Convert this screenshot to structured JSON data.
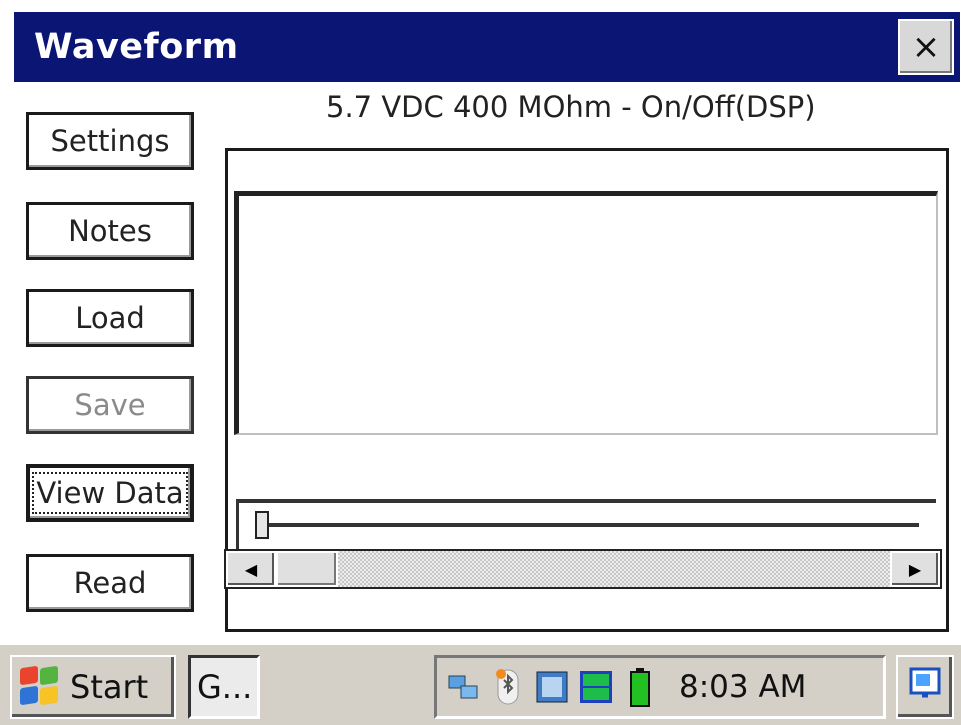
{
  "window": {
    "title": "Waveform",
    "close_label": "×"
  },
  "sidebar": {
    "buttons": [
      {
        "label": "Settings",
        "enabled": true
      },
      {
        "label": "Notes",
        "enabled": true
      },
      {
        "label": "Load",
        "enabled": true
      },
      {
        "label": "Save",
        "enabled": false
      },
      {
        "label": "View Data",
        "enabled": true,
        "focused": true
      },
      {
        "label": "Read",
        "enabled": true
      }
    ]
  },
  "main": {
    "header": "5.7 VDC 400 MOhm - On/Off(DSP)",
    "slider": {
      "value": 0
    },
    "scrollbar": {
      "left_arrow": "◀",
      "right_arrow": "▶",
      "position": 0
    }
  },
  "taskbar": {
    "start_label": "Start",
    "task_label": "G...",
    "tray_icons": [
      "network-icon",
      "bluetooth-icon",
      "sync-icon",
      "otg-icon",
      "battery-icon"
    ],
    "clock": "8:03 AM",
    "corner_icon": "desktop-icon",
    "colors": {
      "battery": "#22c022",
      "title_bar": "#0b1573"
    }
  }
}
